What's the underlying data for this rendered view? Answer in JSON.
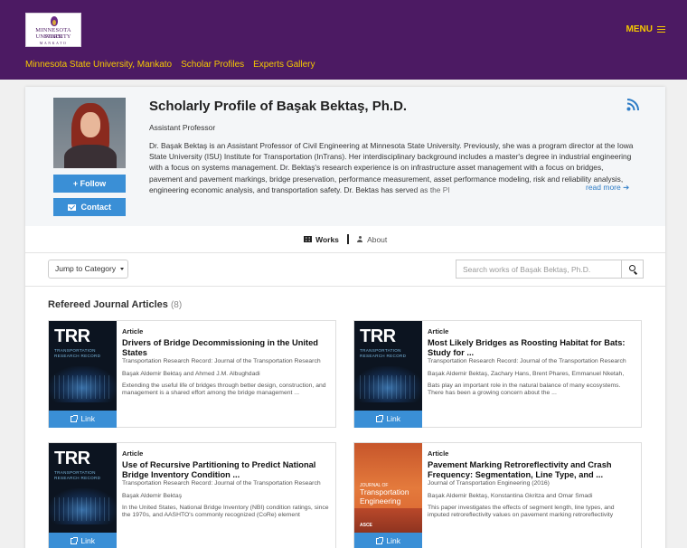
{
  "header": {
    "logo": {
      "line1": "MINNESOTA STATE",
      "line2": "UNIVERSITY",
      "line3": "MANKATO"
    },
    "menu_label": "MENU",
    "breadcrumbs": [
      "Minnesota State University, Mankato",
      "Scholar Profiles",
      "Experts Gallery"
    ]
  },
  "profile": {
    "title": "Scholarly Profile of Başak Bektaş, Ph.D.",
    "role": "Assistant Professor",
    "bio": "Dr. Başak Bektaş is an Assistant Professor of Civil Engineering at Minnesota State University. Previously, she was a program director at the Iowa State University (ISU) Institute for Transportation (InTrans). Her interdisciplinary background includes a master's degree in industrial engineering with a focus on systems management. Dr. Bektaş's research experience is on infrastructure asset management with a focus on bridges, pavement and pavement markings, bridge preservation, performance measurement, asset performance modeling, risk and reliability analysis, engineering economic analysis, and transportation safety. Dr. Bektas has served as the PI",
    "read_more": "read more",
    "follow_label": "Follow",
    "contact_label": "Contact"
  },
  "tabs": {
    "works": "Works",
    "about": "About"
  },
  "toolbar": {
    "jump_label": "Jump to Category",
    "search_placeholder": "Search works of Başak Bektaş, Ph.D."
  },
  "section": {
    "title": "Refereed Journal Articles",
    "count": "(8)"
  },
  "works": [
    {
      "type": "Article",
      "title": "Drivers of Bridge Decommissioning in the United States",
      "journal": "Transportation Research Record: Journal of the Transportation Research",
      "authors": "Başak Aldemir Bektaş and Ahmed J.M. Albughdadi",
      "abstract": "Extending the useful life of bridges through better design, construction, and management is a shared effort among the bridge management ...",
      "link_label": "Link",
      "cover": {
        "brand": "TRR",
        "subtitle": "TRANSPORTATION RESEARCH RECORD"
      }
    },
    {
      "type": "Article",
      "title": "Most Likely Bridges as Roosting Habitat for Bats: Study for ...",
      "journal": "Transportation Research Record: Journal of the Transportation Research",
      "authors": "Başak Aldemir Bektaş, Zachary Hans, Brent Phares, Emmanuel Nketah,",
      "abstract": "Bats play an important role in the natural balance of many ecosystems. There has been a growing concern about the ...",
      "link_label": "Link",
      "cover": {
        "brand": "TRR",
        "subtitle": "TRANSPORTATION RESEARCH RECORD"
      }
    },
    {
      "type": "Article",
      "title": "Use of Recursive Partitioning to Predict National Bridge Inventory Condition ...",
      "journal": "Transportation Research Record: Journal of the Transportation Research",
      "authors": "Başak Aldemir Bektaş",
      "abstract": "In the United States, National Bridge Inventory (NBI) condition ratings, since the 1970s, and AASHTO's commonly recognized (CoRe) element",
      "link_label": "Link",
      "cover": {
        "brand": "TRR",
        "subtitle": "TRANSPORTATION RESEARCH RECORD"
      }
    },
    {
      "type": "Article",
      "title": "Pavement Marking Retroreflectivity and Crash Frequency: Segmentation, Line Type, and ...",
      "journal": "Journal of Transportation Engineering (2016)",
      "authors": "Başak Aldemir Bektaş, Konstantina Gkritza and Omar Smadi",
      "abstract": "This paper investigates the effects of segment length, line types, and imputed retroreflectivity values on pavement marking retroreflectivity",
      "link_label": "Link",
      "cover": {
        "label": "JOURNAL OF",
        "title": "Transportation Engineering",
        "mark": "ASCE"
      }
    }
  ],
  "colors": {
    "header_bg": "#4c1a63",
    "accent_gold": "#f6c800",
    "button_blue": "#3a8fd6",
    "link_blue": "#2d7cc6"
  }
}
